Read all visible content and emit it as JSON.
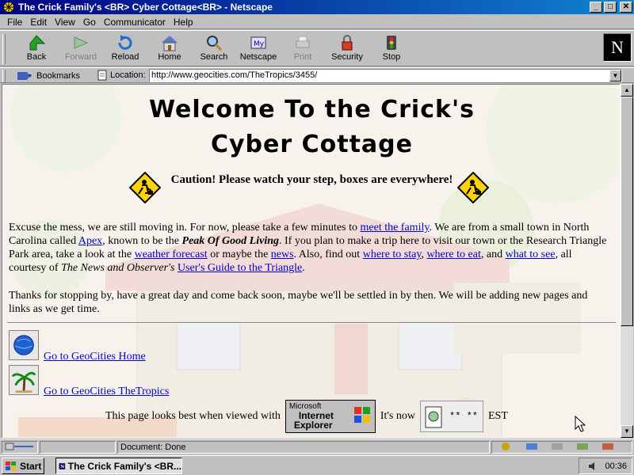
{
  "window": {
    "title": "The Crick Family's <BR> Cyber Cottage<BR> - Netscape",
    "minimize": "_",
    "maximize": "□",
    "close": "✕"
  },
  "menu": [
    "File",
    "Edit",
    "View",
    "Go",
    "Communicator",
    "Help"
  ],
  "toolbar": [
    {
      "label": "Back",
      "icon": "back-arrow-icon",
      "enabled": true
    },
    {
      "label": "Forward",
      "icon": "forward-arrow-icon",
      "enabled": false
    },
    {
      "label": "Reload",
      "icon": "reload-icon",
      "enabled": true
    },
    {
      "label": "Home",
      "icon": "home-icon",
      "enabled": true
    },
    {
      "label": "Search",
      "icon": "search-icon",
      "enabled": true
    },
    {
      "label": "Netscape",
      "icon": "netscape-icon",
      "enabled": true
    },
    {
      "label": "Print",
      "icon": "print-icon",
      "enabled": false
    },
    {
      "label": "Security",
      "icon": "lock-icon",
      "enabled": true
    },
    {
      "label": "Stop",
      "icon": "stop-icon",
      "enabled": true
    }
  ],
  "throbber": "N",
  "location": {
    "bookmarks_label": "Bookmarks",
    "location_label": "Location:",
    "url": "http://www.geocities.com/TheTropics/3455/"
  },
  "page": {
    "title_line1": "Welcome To the Crick's",
    "title_line2": "Cyber Cottage",
    "caution": "Caution! Please watch your step, boxes are everywhere!",
    "p1": {
      "t1": "Excuse the mess, we are still moving in. For now, please take a few minutes to ",
      "l1": "meet the family",
      "t2": ". We are from a small town in North Carolina called ",
      "l2": "Apex",
      "t3": ", known to be the ",
      "b1": "Peak Of Good Living",
      "t4": ". If you plan to make a trip here to visit our town or the Research Triangle Park area, take a look at the ",
      "l3": "weather forecast",
      "t5": " or maybe the ",
      "l4": "news",
      "t6": ". Also, find out ",
      "l5": "where to stay",
      "t7": ", ",
      "l6": "where to eat",
      "t8": ", and ",
      "l7": "what to see",
      "t9": ", all courtesy of ",
      "i1": "The News and Observer's",
      "t10": " ",
      "l8": "User's Guide to the Triangle",
      "t11": "."
    },
    "p2": "Thanks for stopping by, have a great day and come back soon, maybe we'll be settled in by then. We will be adding new pages and links as we get time.",
    "link_geocities_home": "Go to GeoCities Home",
    "link_tropics": "Go to GeoCities TheTropics",
    "best_viewed": "This page looks best when viewed with",
    "ie_badge": {
      "line0": "Microsoft",
      "line1": "Internet",
      "line2": "Explorer"
    },
    "its_now": "It's now",
    "clock": "** **",
    "tz": "EST"
  },
  "status": {
    "text": "Document: Done"
  },
  "taskbar": {
    "start": "Start",
    "task": "The Crick Family's <BR...",
    "clock": "00:36"
  }
}
